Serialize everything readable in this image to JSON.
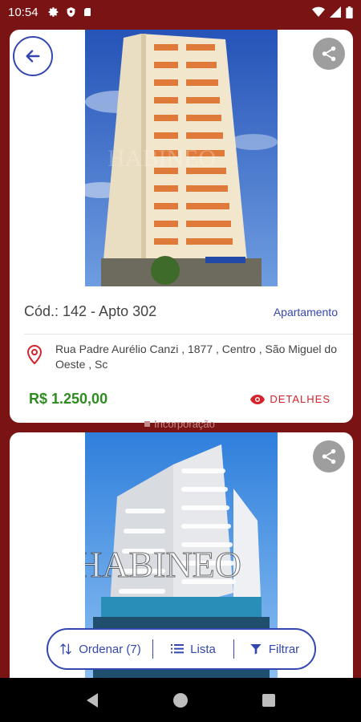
{
  "status_bar": {
    "time": "10:54"
  },
  "listings": [
    {
      "code": "Cód.: 142 - Apto 302",
      "type": "Apartamento",
      "address": "Rua Padre Aurélio Canzi , 1877 , Centro , São Miguel do Oeste , Sc",
      "price": "R$  1.250,00",
      "details_label": "DETALHES"
    },
    {
      "under_label": "Incorporação",
      "watermark": "HABINEO"
    }
  ],
  "toolbar": {
    "sort_label": "Ordenar (7)",
    "list_label": "Lista",
    "filter_label": "Filtrar"
  },
  "colors": {
    "background": "#7a1414",
    "accent": "#3347b0",
    "price": "#2e8b20",
    "details": "#d3232b"
  }
}
